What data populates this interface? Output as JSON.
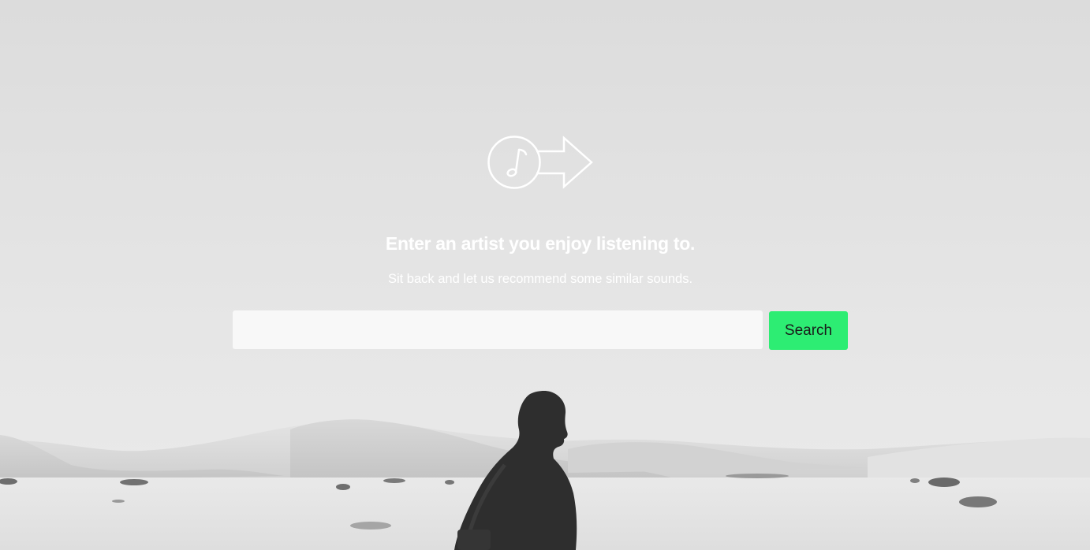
{
  "hero": {
    "logo_icon": "music-note-arrow-icon",
    "headline": "Enter an artist you enjoy listening to.",
    "subline": "Sit back and let us recommend some similar sounds."
  },
  "search": {
    "value": "",
    "placeholder": "",
    "button_label": "Search"
  },
  "colors": {
    "accent": "#2ded73",
    "text_on_image": "#ffffff",
    "input_background": "#f8f8f8"
  }
}
